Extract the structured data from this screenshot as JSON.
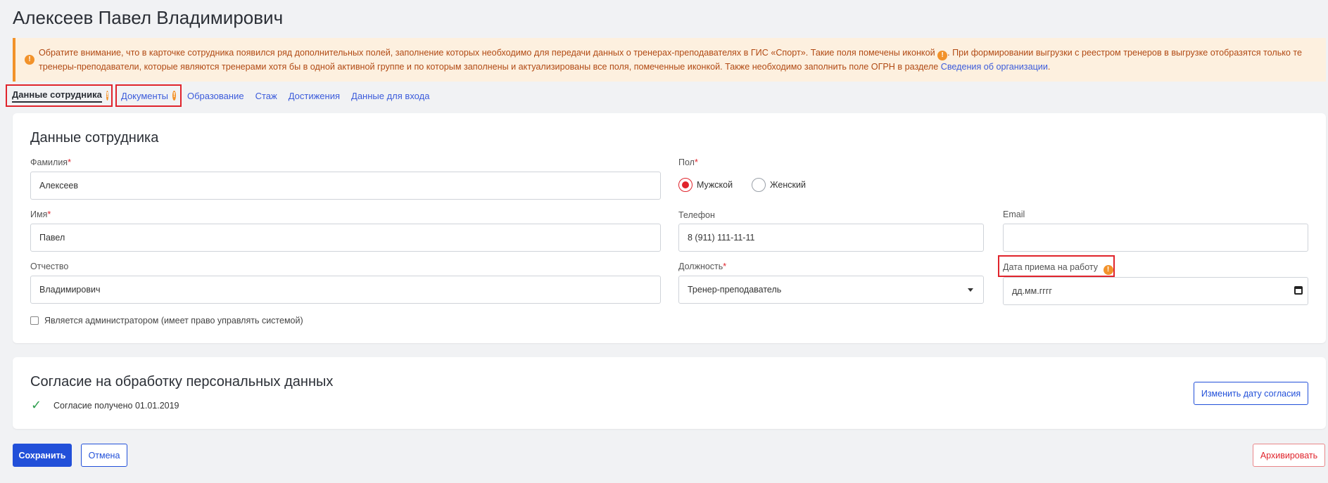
{
  "page": {
    "title": "Алексеев Павел Владимирович"
  },
  "alert": {
    "text_before": "Обратите внимание, что в карточке сотрудника появился ряд дополнительных полей, заполнение которых необходимо для передачи данных о тренерах-преподавателях в ГИС «Спорт». Такие поля помечены иконкой ",
    "text_middle": ". При формировании выгрузки с реестром тренеров в выгрузке отобразятся только те тренеры-преподаватели, которые являются тренерами хотя бы в одной активной группе и по которым заполнены и актуализированы все поля, помеченные иконкой. Также необходимо заполнить поле ОГРН в разделе ",
    "link": "Сведения об организации",
    "text_after": ".",
    "icon": "warning-icon",
    "warn_glyph": "!"
  },
  "tabs": [
    {
      "label": "Данные сотрудника",
      "active": true,
      "warn": true
    },
    {
      "label": "Документы",
      "active": false,
      "warn": true
    },
    {
      "label": "Образование"
    },
    {
      "label": "Стаж"
    },
    {
      "label": "Достижения"
    },
    {
      "label": "Данные для входа"
    }
  ],
  "employee": {
    "title": "Данные сотрудника",
    "lastname": {
      "label": "Фамилия",
      "value": "Алексеев",
      "required": "*"
    },
    "firstname": {
      "label": "Имя",
      "value": "Павел",
      "required": "*"
    },
    "middlename": {
      "label": "Отчество",
      "value": "Владимирович"
    },
    "gender": {
      "label": "Пол",
      "required": "*",
      "options": [
        "Мужской",
        "Женский"
      ],
      "selected": "Мужской"
    },
    "phone": {
      "label": "Телефон",
      "value": "8 (911) 111-11-11"
    },
    "email": {
      "label": "Email",
      "value": ""
    },
    "position": {
      "label": "Должность",
      "required": "*",
      "value": "Тренер-преподаватель"
    },
    "hire_date": {
      "label": "Дата приема на работу",
      "placeholder": "дд.мм.гггг"
    },
    "is_admin": {
      "label": "Является администратором (имеет право управлять системой)",
      "checked": false
    }
  },
  "consent": {
    "title": "Согласие на обработку персональных данных",
    "status": "Согласие получено 01.01.2019",
    "change_button": "Изменить дату согласия"
  },
  "actions": {
    "save": "Сохранить",
    "cancel": "Отмена",
    "archive": "Архивировать"
  },
  "colors": {
    "accent": "#2250d9",
    "warning": "#f2922a",
    "danger": "#e0242c",
    "success": "#2e9e4f"
  }
}
